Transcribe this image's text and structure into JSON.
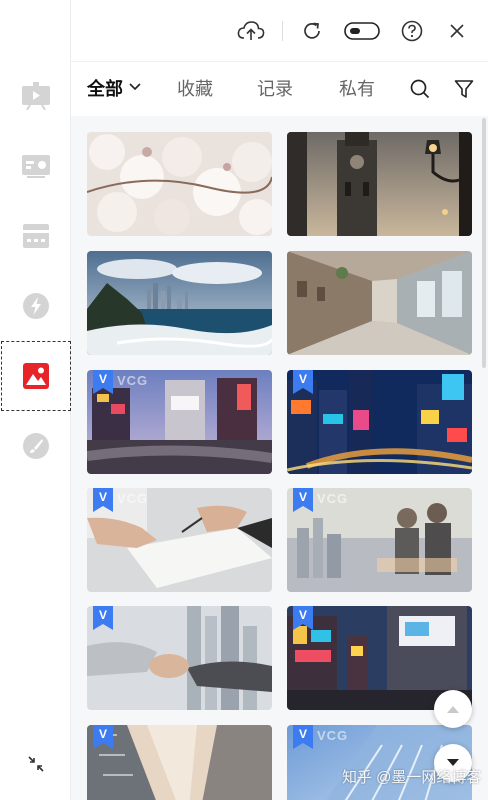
{
  "colors": {
    "accent": "#e5252a",
    "rail_icon": "#d4d4d4",
    "text_dark": "#111111",
    "text_muted": "#666666",
    "badge_blue": "#3d7cf0"
  },
  "toolbar": {
    "cloud_upload": "cloud-upload-icon",
    "refresh": "refresh-icon",
    "toggle": "toggle-icon",
    "help": "help-icon",
    "close": "close-icon"
  },
  "rail": {
    "items": [
      {
        "icon": "video-slide-icon",
        "active": false
      },
      {
        "icon": "text-box-icon",
        "active": false
      },
      {
        "icon": "card-icon",
        "active": false
      },
      {
        "icon": "lightning-icon",
        "active": false
      },
      {
        "icon": "image-icon",
        "active": true
      },
      {
        "icon": "brush-icon",
        "active": false
      }
    ],
    "collapse_icon": "collapse-icon"
  },
  "tabs": [
    {
      "label": "全部",
      "active": true
    },
    {
      "label": "收藏",
      "active": false
    },
    {
      "label": "记录",
      "active": false
    },
    {
      "label": "私有",
      "active": false
    }
  ],
  "tab_icons": {
    "search": "search-icon",
    "filter": "filter-icon"
  },
  "images": [
    {
      "subject": "cherry blossoms",
      "premium": false
    },
    {
      "subject": "clock tower and street lamp",
      "premium": false
    },
    {
      "subject": "coastal city skyline",
      "premium": false
    },
    {
      "subject": "old town street",
      "premium": false
    },
    {
      "subject": "Shibuya crossing at dusk",
      "premium": true
    },
    {
      "subject": "Times Square at night",
      "premium": true
    },
    {
      "subject": "signing a contract",
      "premium": true
    },
    {
      "subject": "business team double exposure",
      "premium": true
    },
    {
      "subject": "handshake over city",
      "premium": true
    },
    {
      "subject": "Shibuya crossing at night",
      "premium": true
    },
    {
      "subject": "skyscrapers looking up",
      "premium": true
    },
    {
      "subject": "glass office tower",
      "premium": true
    }
  ],
  "badge": {
    "letter": "V",
    "brand": "VCG"
  },
  "float_buttons": {
    "up": "scroll-up-icon",
    "down": "scroll-down-icon"
  },
  "watermark": "知乎 @墨一网络博客"
}
